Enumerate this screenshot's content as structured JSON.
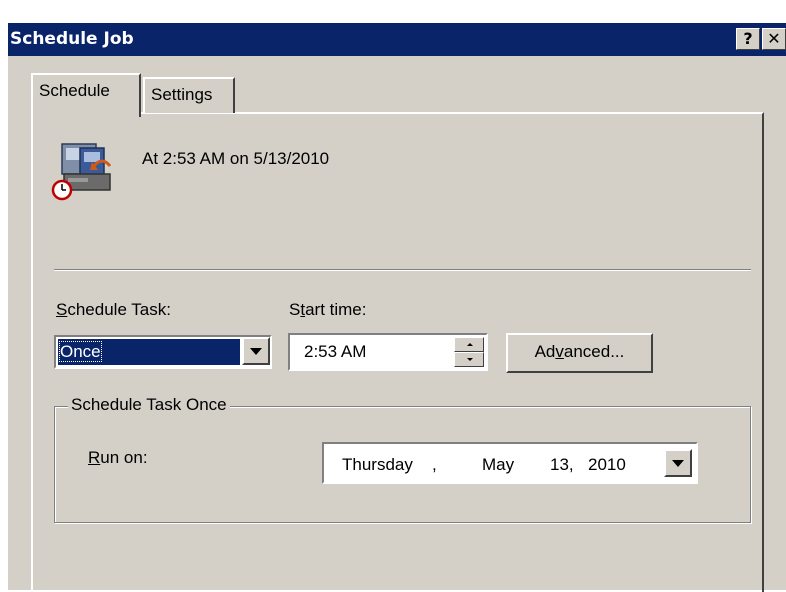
{
  "window": {
    "title": "Schedule Job",
    "help_label": "?",
    "close_label": "✕",
    "titlebar_color": "#0a246a"
  },
  "tabs": [
    {
      "label": "Schedule",
      "active": true
    },
    {
      "label": "Settings",
      "active": false
    }
  ],
  "summary": {
    "icon": "scheduled-task-icon",
    "text": "At 2:53 AM on 5/13/2010"
  },
  "schedule_task": {
    "label_mnemonic": "S",
    "label_rest": "chedule Task:",
    "value": "Once"
  },
  "start_time": {
    "label_pre": "S",
    "label_mnemonic": "t",
    "label_rest": "art time:",
    "value": "2:53 AM"
  },
  "advanced_button": {
    "label_pre": "Ad",
    "label_mnemonic": "v",
    "label_rest": "anced..."
  },
  "group": {
    "title": "Schedule Task Once",
    "run_on_mnemonic": "R",
    "run_on_rest": "un on:",
    "date": {
      "weekday": "Thursday",
      "sep": ",",
      "month": "May",
      "day": "13,",
      "year": "2010"
    }
  }
}
